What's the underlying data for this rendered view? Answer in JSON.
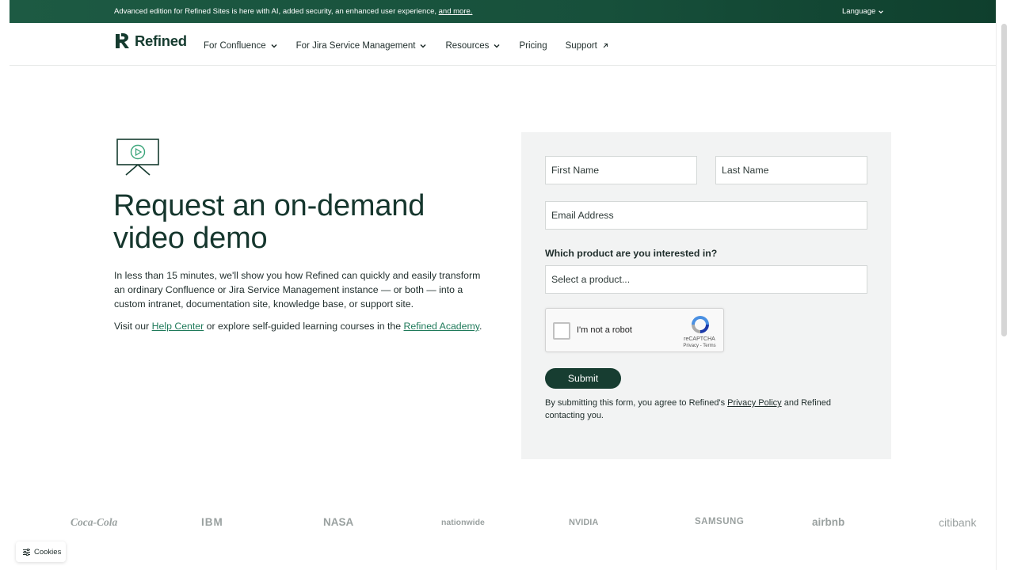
{
  "announcement": {
    "text": "Advanced edition for Refined Sites is here with AI, added security, an enhanced user experience,",
    "link": "and more.",
    "language": "Language"
  },
  "nav": {
    "logo_text": "Refined",
    "items": [
      {
        "label": "For Confluence",
        "has_caret": true
      },
      {
        "label": "For Jira Service Management",
        "has_caret": true
      },
      {
        "label": "Resources",
        "has_caret": true
      },
      {
        "label": "Pricing",
        "has_caret": false
      },
      {
        "label": "Support",
        "has_caret": false
      }
    ]
  },
  "hero": {
    "title": "Request an on-demand video demo",
    "description": "In less than 15 minutes, we'll show you how Refined can quickly and easily transform an ordinary Confluence or Jira Service Management instance — or both — into a custom intranet, documentation site, knowledge base, or support site.",
    "links_prefix": "Visit our",
    "help_center": "Help Center",
    "links_middle": "or explore self-guided learning courses in the",
    "academy": "Refined Academy",
    "links_suffix": "."
  },
  "form": {
    "first_name_placeholder": "First Name",
    "last_name_placeholder": "Last Name",
    "email_placeholder": "Email Address",
    "product_question": "Which product are you interested in?",
    "product_placeholder": "Select a product...",
    "captcha_label": "I'm not a robot",
    "captcha_brand": "reCAPTCHA",
    "captcha_terms": "Privacy - Terms",
    "submit_label": "Submit",
    "agree_prefix": "By submitting this form, you agree to Refined's",
    "privacy_policy": "Privacy Policy",
    "agree_suffix": "and Refined contacting you."
  },
  "customer_logos": [
    "Coca-Cola",
    "IBM",
    "NASA",
    "nationwide",
    "NVIDIA",
    "SAMSUNG",
    "airbnb",
    "citibank"
  ],
  "cookies_label": "Cookies",
  "colors": {
    "brand_green": "#173d31",
    "announce_green": "#1d5a43",
    "link_green": "#1f7a5a",
    "form_bg": "#f2f3f3"
  }
}
